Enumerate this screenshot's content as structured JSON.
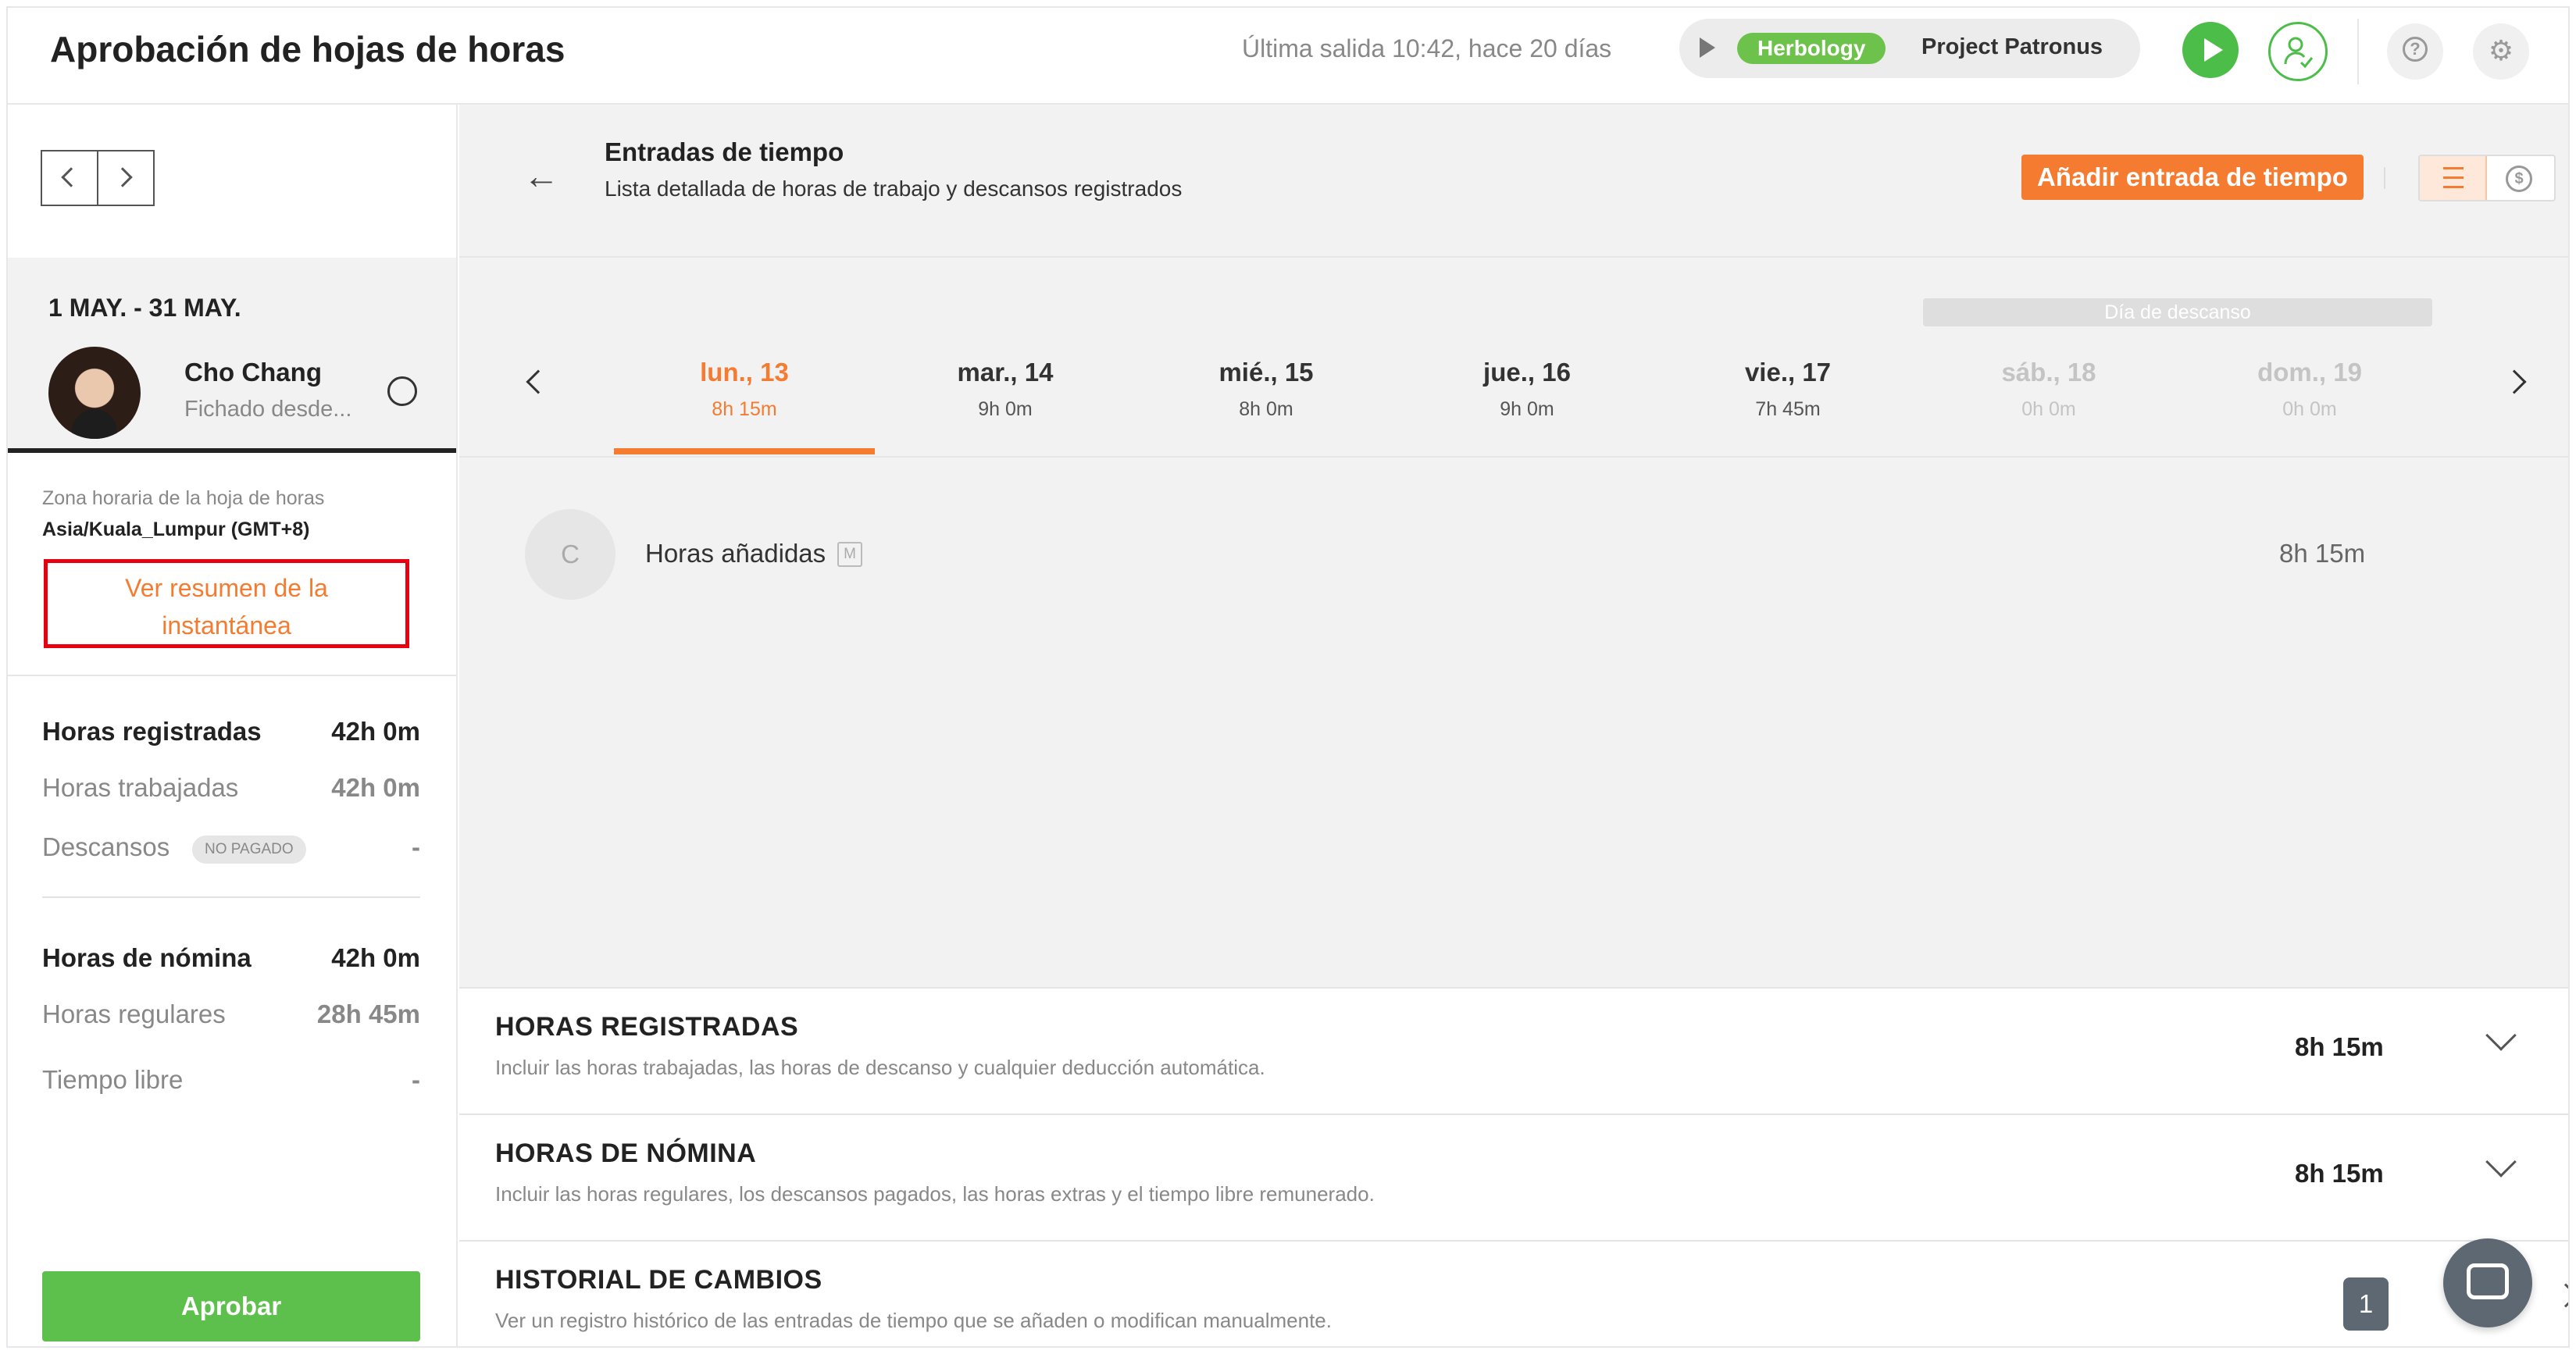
{
  "header": {
    "title": "Aprobación de hojas de horas",
    "last_clock_out": "Última salida 10:42, hace 20 días",
    "timer": {
      "activity": "Herbology",
      "project": "Project Patronus"
    },
    "icons": {
      "play": "play-icon",
      "user": "user-check-icon",
      "help": "help-icon",
      "settings": "settings-icon"
    }
  },
  "sidebar": {
    "period": "1 MAY. - 31 MAY.",
    "employee": {
      "name": "Cho Chang",
      "status": "Fichado desde..."
    },
    "timezone_label": "Zona horaria de la hoja de horas",
    "timezone_value": "Asia/Kuala_Lumpur (GMT+8)",
    "snapshot_link": "Ver resumen de la instantánea",
    "stats": [
      {
        "label": "Horas registradas",
        "value": "42h 0m",
        "strong": true
      },
      {
        "label": "Horas trabajadas",
        "value": "42h 0m",
        "strong": false
      },
      {
        "label": "Descansos",
        "value": "-",
        "badge": "NO PAGADO",
        "strong": false
      }
    ],
    "payroll": [
      {
        "label": "Horas de nómina",
        "value": "42h 0m",
        "strong": true
      },
      {
        "label": "Horas regulares",
        "value": "28h 45m",
        "strong": false
      },
      {
        "label": "Tiempo libre",
        "value": "-",
        "strong": false
      }
    ],
    "approve_label": "Aprobar"
  },
  "main": {
    "section_title": "Entradas de tiempo",
    "section_subtitle": "Lista detallada de horas de trabajo y descansos registrados",
    "add_button": "Añadir entrada de tiempo",
    "money_symbol": "$",
    "rest_day_label": "Día de descanso",
    "days": [
      {
        "name": "lun., 13",
        "hours": "8h 15m",
        "state": "active"
      },
      {
        "name": "mar., 14",
        "hours": "9h 0m",
        "state": "normal"
      },
      {
        "name": "mié., 15",
        "hours": "8h 0m",
        "state": "normal"
      },
      {
        "name": "jue., 16",
        "hours": "9h 0m",
        "state": "normal"
      },
      {
        "name": "vie., 17",
        "hours": "7h 45m",
        "state": "normal"
      },
      {
        "name": "sáb., 18",
        "hours": "0h 0m",
        "state": "muted"
      },
      {
        "name": "dom., 19",
        "hours": "0h 0m",
        "state": "muted"
      }
    ],
    "entry": {
      "initial": "C",
      "label": "Horas añadidas",
      "tag": "M",
      "hours": "8h 15m"
    },
    "panels": [
      {
        "title": "HORAS REGISTRADAS",
        "subtitle": "Incluir las horas trabajadas, las horas de descanso y cualquier deducción automática.",
        "value": "8h 15m"
      },
      {
        "title": "HORAS DE NÓMINA",
        "subtitle": "Incluir las horas regulares, los descansos pagados, las horas extras y el tiempo libre remunerado.",
        "value": "8h 15m"
      },
      {
        "title": "HISTORIAL DE CAMBIOS",
        "subtitle": "Ver un registro histórico de las entradas de tiempo que se añaden o modifican manualmente.",
        "badge": "1"
      }
    ]
  },
  "colors": {
    "accent": "#f47b30",
    "success": "#5ec04c",
    "highlight_box": "#e60012"
  }
}
